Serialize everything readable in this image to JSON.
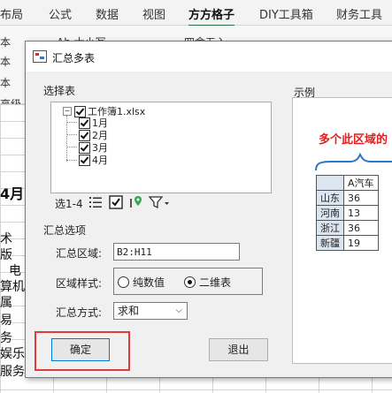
{
  "excel": {
    "ribbon_tabs": [
      "布局",
      "公式",
      "数据",
      "视图",
      "方方格子",
      "DIY工具箱",
      "财务工具"
    ],
    "active_tab": "方方格子",
    "ribbon_texts": [
      "本",
      "Ab 大小写",
      "四舍五入",
      "本",
      "本",
      "高级"
    ],
    "left_cells": [
      "4月",
      "术",
      "版",
      "电",
      "算机",
      "属",
      "易",
      "务",
      "娱乐",
      "服务"
    ]
  },
  "dialog": {
    "title": "汇总多表",
    "select_group_label": "选择表",
    "tree": {
      "root": "工作簿1.xlsx",
      "children": [
        "1月",
        "2月",
        "3月",
        "4月"
      ]
    },
    "toolbar_label": "选1-4",
    "options_group_label": "汇总选项",
    "range_label": "汇总区域:",
    "range_value": "B2:H11",
    "style_label": "区域样式:",
    "style_options": [
      "纯数值",
      "二维表"
    ],
    "style_selected": "二维表",
    "method_label": "汇总方式:",
    "method_value": "求和",
    "ok_label": "确定",
    "exit_label": "退出",
    "example_label": "示例",
    "example": {
      "heading": "多个此区域的",
      "header": [
        "",
        "A汽车"
      ],
      "rows": [
        [
          "山东",
          "36"
        ],
        [
          "河南",
          "13"
        ],
        [
          "浙江",
          "36"
        ],
        [
          "新疆",
          "19"
        ]
      ]
    }
  },
  "colors": {
    "highlight": "#e03a3a",
    "example_heading": "#e02020",
    "excel_green": "#217346"
  }
}
